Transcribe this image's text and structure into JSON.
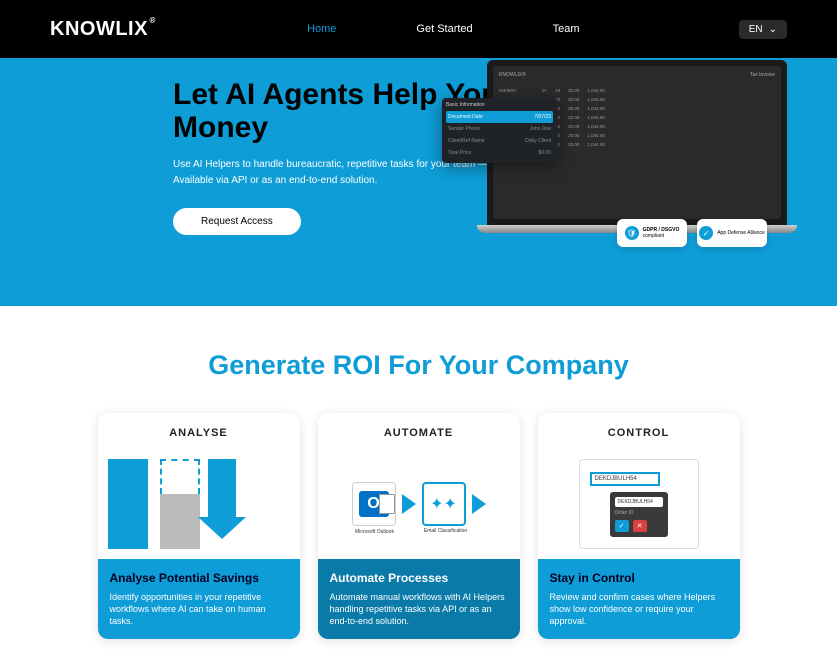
{
  "nav": {
    "logo": "KNOWLIX",
    "logo_sup": "®",
    "links": [
      "Home",
      "Get Started",
      "Team"
    ],
    "lang": "EN"
  },
  "hero": {
    "title": "Let AI Agents Help Your Company Save Money",
    "line1": "Use AI Helpers to handle bureaucratic, repetitive tasks for your team — with outstanding accuracy and autonomy.",
    "line2": "Available via API or as an end-to-end solution.",
    "cta": "Request Access"
  },
  "mock": {
    "logo": "KNOWLIX®",
    "doc": "Tax Invoice",
    "popup_hdr": "Basic Information",
    "popup": [
      {
        "k": "Document Date",
        "v": "7/07/23",
        "hl": true
      },
      {
        "k": "Sender Phone",
        "v": "John Doe"
      },
      {
        "k": "Client/Ref Name",
        "v": "Orbly Client"
      },
      {
        "k": "Total Price",
        "v": "$0.00"
      }
    ]
  },
  "badges": {
    "gdpr": "GDPR / DSGVO",
    "gdpr_sub": "compliant",
    "app": "App Defense Alliance"
  },
  "section2_title": "Generate ROI For Your Company",
  "cards": [
    {
      "cat": "ANALYSE",
      "title": "Analyse Potential Savings",
      "text": "Identify opportunities in your repetitive workflows where AI can take on human tasks."
    },
    {
      "cat": "AUTOMATE",
      "title": "Automate Processes",
      "text": "Automate manual workflows with AI Helpers handling repetitive tasks via API or as an end-to-end solution.",
      "outlook": "Microsoft Outlook",
      "classify": "Email Classification"
    },
    {
      "cat": "CONTROL",
      "title": "Stay in Control",
      "text": "Review and confirm cases where Helpers show low confidence or require your approval.",
      "code": "DEKDJBULH54",
      "label": "Order ID"
    }
  ]
}
